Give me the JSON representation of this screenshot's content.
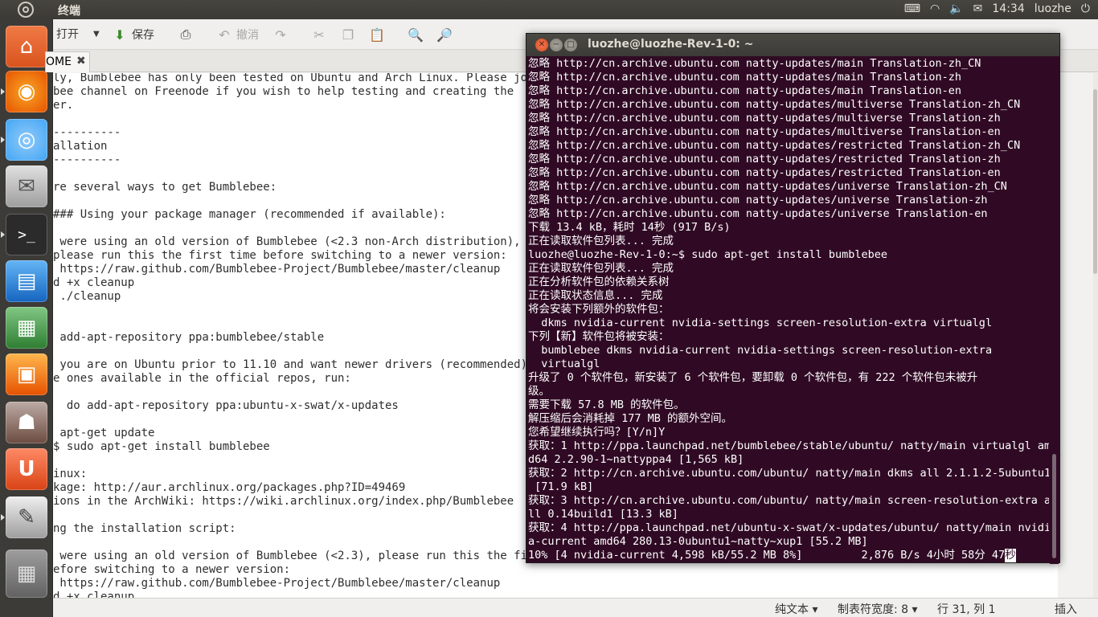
{
  "top_panel": {
    "title": "终端",
    "time": "14:34",
    "user": "luozhe",
    "icons": [
      "keyboard-icon",
      "wifi-icon",
      "volume-icon",
      "mail-icon",
      "power-icon"
    ]
  },
  "launcher": {
    "items": [
      "home-folder",
      "firefox",
      "chromium",
      "mail-client",
      "terminal",
      "writer",
      "calc",
      "impress",
      "software-center",
      "ubuntu-one",
      "text-editor",
      "workspaces"
    ]
  },
  "editor": {
    "toolbar": {
      "open": "打开",
      "save": "保存",
      "undo": "撤消"
    },
    "tab_label": "OME",
    "lines": [
      "ly, Bumblebee has only been tested on Ubuntu and Arch Linux. Please join",
      "bee channel on Freenode if you wish to help testing and creating the",
      "er.",
      "",
      "----------",
      "allation",
      "----------",
      "",
      "re several ways to get Bumblebee:",
      "",
      "### Using your package manager (recommended if available):",
      "",
      " were using an old version of Bumblebee (<2.3 non-Arch distribution),",
      "please run this the first time before switching to a newer version:",
      " https://raw.github.com/Bumblebee-Project/Bumblebee/master/cleanup",
      "d +x cleanup",
      " ./cleanup",
      "",
      "",
      " add-apt-repository ppa:bumblebee/stable",
      "",
      " you are on Ubuntu prior to 11.10 and want newer drivers (recommended)",
      "e ones available in the official repos, run:",
      "",
      "  do add-apt-repository ppa:ubuntu-x-swat/x-updates",
      "",
      " apt-get update",
      "$ sudo apt-get install bumblebee",
      "",
      "inux:",
      "kage: http://aur.archlinux.org/packages.php?ID=49469",
      "ions in the ArchWiki: https://wiki.archlinux.org/index.php/Bumblebee",
      "",
      "ng the installation script:",
      "",
      " were using an old version of Bumblebee (<2.3), please run this the first",
      "efore switching to a newer version:",
      " https://raw.github.com/Bumblebee-Project/Bumblebee/master/cleanup",
      "d +x cleanup"
    ],
    "status": {
      "mode": "纯文本",
      "tab_width": "制表符宽度: 8",
      "position": "行 31, 列 1",
      "insert": "插入"
    }
  },
  "terminal": {
    "title": "luozhe@luozhe-Rev-1-0: ~",
    "lines": [
      "忽略 http://cn.archive.ubuntu.com natty-updates/main Translation-zh_CN",
      "忽略 http://cn.archive.ubuntu.com natty-updates/main Translation-zh",
      "忽略 http://cn.archive.ubuntu.com natty-updates/main Translation-en",
      "忽略 http://cn.archive.ubuntu.com natty-updates/multiverse Translation-zh_CN",
      "忽略 http://cn.archive.ubuntu.com natty-updates/multiverse Translation-zh",
      "忽略 http://cn.archive.ubuntu.com natty-updates/multiverse Translation-en",
      "忽略 http://cn.archive.ubuntu.com natty-updates/restricted Translation-zh_CN",
      "忽略 http://cn.archive.ubuntu.com natty-updates/restricted Translation-zh",
      "忽略 http://cn.archive.ubuntu.com natty-updates/restricted Translation-en",
      "忽略 http://cn.archive.ubuntu.com natty-updates/universe Translation-zh_CN",
      "忽略 http://cn.archive.ubuntu.com natty-updates/universe Translation-zh",
      "忽略 http://cn.archive.ubuntu.com natty-updates/universe Translation-en",
      "下载 13.4 kB，耗时 14秒 (917 B/s)",
      "正在读取软件包列表... 完成",
      "luozhe@luozhe-Rev-1-0:~$ sudo apt-get install bumblebee",
      "正在读取软件包列表... 完成",
      "正在分析软件包的依赖关系树",
      "正在读取状态信息... 完成",
      "将会安装下列额外的软件包：",
      "  dkms nvidia-current nvidia-settings screen-resolution-extra virtualgl",
      "下列【新】软件包将被安装：",
      "  bumblebee dkms nvidia-current nvidia-settings screen-resolution-extra",
      "  virtualgl",
      "升级了 0 个软件包，新安装了 6 个软件包，要卸载 0 个软件包，有 222 个软件包未被升",
      "级。",
      "需要下载 57.8 MB 的软件包。",
      "解压缩后会消耗掉 177 MB 的额外空间。",
      "您希望继续执行吗？[Y/n]Y",
      "获取：1 http://ppa.launchpad.net/bumblebee/stable/ubuntu/ natty/main virtualgl am",
      "d64 2.2.90-1~nattyppa4 [1,565 kB]",
      "获取：2 http://cn.archive.ubuntu.com/ubuntu/ natty/main dkms all 2.1.1.2-5ubuntu1",
      " [71.9 kB]",
      "获取：3 http://cn.archive.ubuntu.com/ubuntu/ natty/main screen-resolution-extra a",
      "ll 0.14build1 [13.3 kB]",
      "获取：4 http://ppa.launchpad.net/ubuntu-x-swat/x-updates/ubuntu/ natty/main nvidi",
      "a-current amd64 280.13-0ubuntu1~natty~xup1 [55.2 MB]"
    ],
    "progress_line": "10% [4 nvidia-current 4,598 kB/55.2 MB 8%]         2,876 B/s 4小时 58分 47",
    "cursor_char": "秒"
  }
}
